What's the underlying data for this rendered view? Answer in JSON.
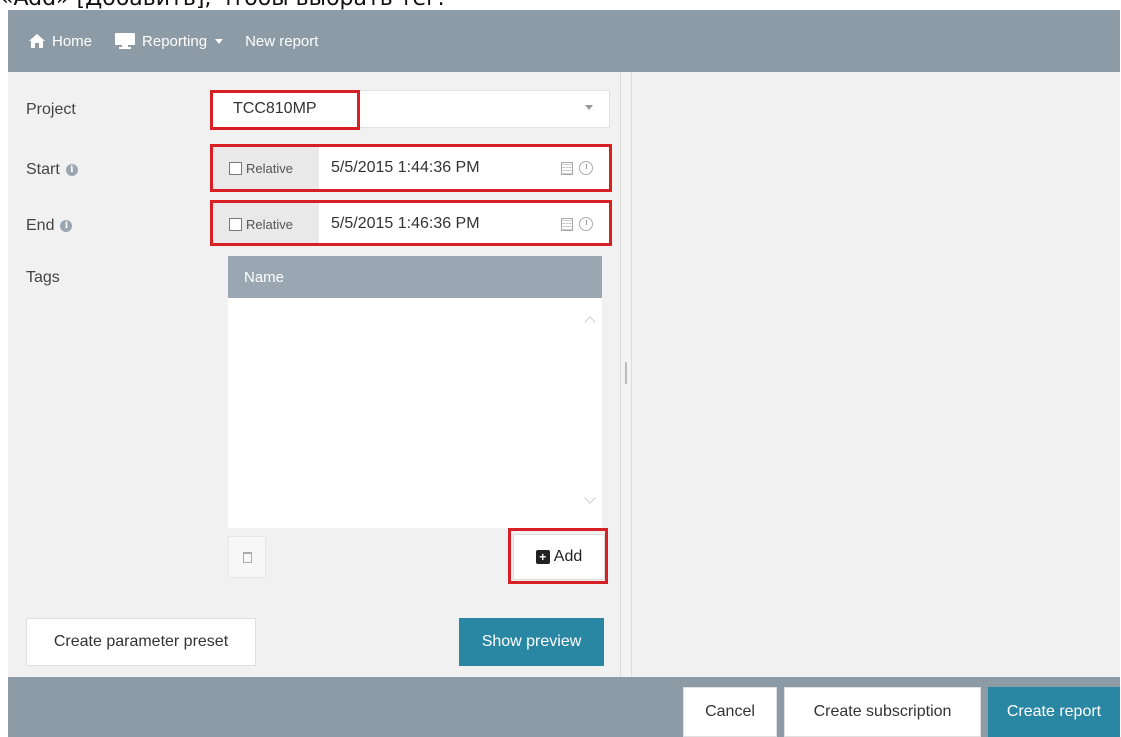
{
  "caption": "«Add» [Добавить], чтобы выбрать тег.",
  "nav": {
    "home": "Home",
    "reporting": "Reporting",
    "new_report": "New report"
  },
  "form": {
    "project_label": "Project",
    "project_value": "TCC810MP",
    "start_label": "Start",
    "start_relative": "Relative",
    "start_value": "5/5/2015 1:44:36 PM",
    "end_label": "End",
    "end_relative": "Relative",
    "end_value": "5/5/2015 1:46:36 PM",
    "tags_label": "Tags",
    "tags_column": "Name",
    "add_label": "Add"
  },
  "actions": {
    "preset": "Create parameter preset",
    "preview": "Show preview"
  },
  "footer": {
    "cancel": "Cancel",
    "subscription": "Create subscription",
    "create": "Create report"
  },
  "colors": {
    "navbar": "#8d9ba6",
    "primary_button": "#2a87a4",
    "highlight": "#d71f26"
  }
}
